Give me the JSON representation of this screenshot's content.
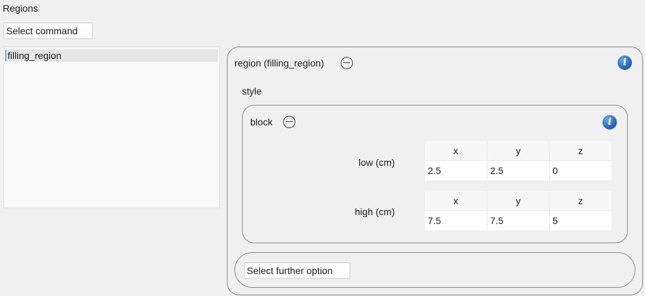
{
  "header": {
    "title": "Regions"
  },
  "command_select": {
    "label": "Select command"
  },
  "regions_list": {
    "items": [
      {
        "label": "filling_region"
      }
    ]
  },
  "region_panel": {
    "title": "region (filling_region)",
    "style_label": "style",
    "block": {
      "title": "block",
      "low": {
        "label": "low (cm)",
        "headers": [
          "x",
          "y",
          "z"
        ],
        "values": [
          "2.5",
          "2.5",
          "0"
        ]
      },
      "high": {
        "label": "high (cm)",
        "headers": [
          "x",
          "y",
          "z"
        ],
        "values": [
          "7.5",
          "7.5",
          "5"
        ]
      }
    },
    "further_option": {
      "label": "Select further option"
    }
  },
  "icons": {
    "collapse": "minus-circle-icon",
    "info": "info-icon"
  },
  "colors": {
    "info_blue": "#2a6db8",
    "background": "#f0f0f0",
    "selection": "#e6e6e6"
  }
}
